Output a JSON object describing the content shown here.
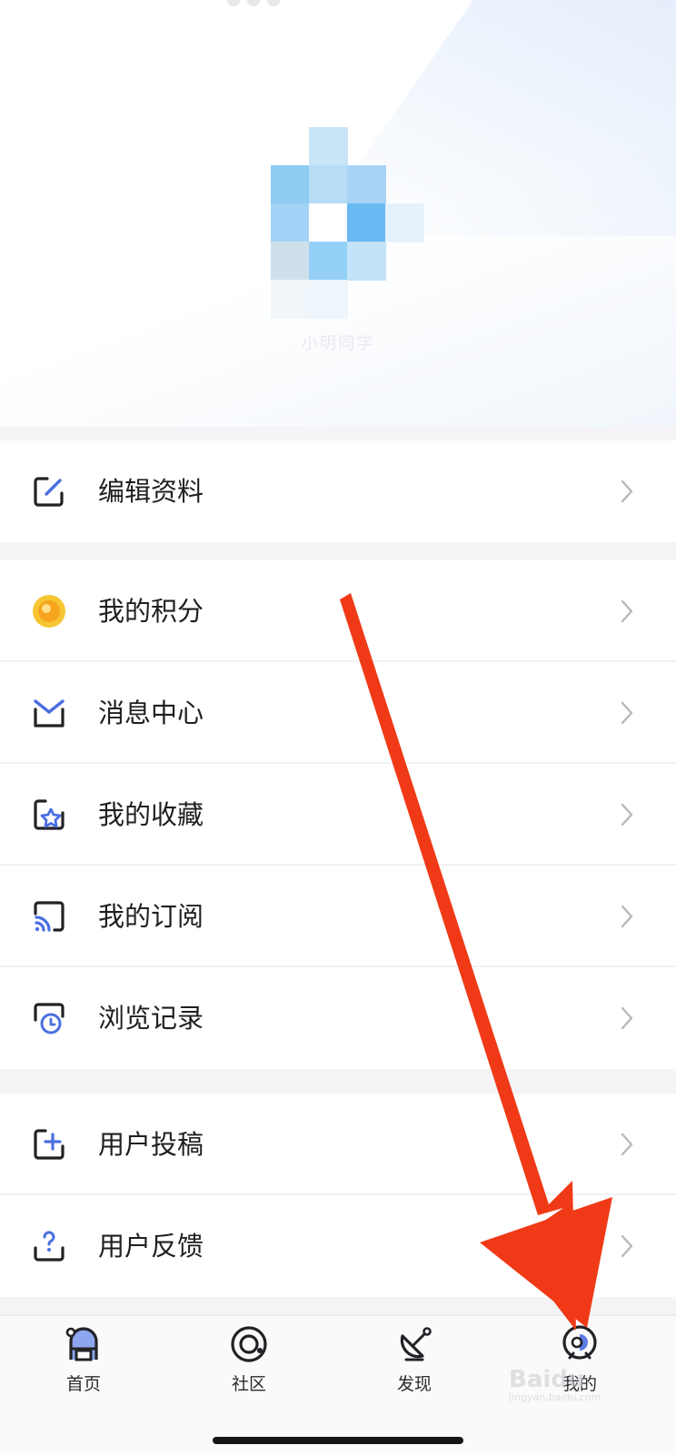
{
  "profile": {
    "username": "小明同学"
  },
  "menu": {
    "group1": [
      {
        "label": "编辑资料",
        "icon": "edit-icon"
      }
    ],
    "group2": [
      {
        "label": "我的积分",
        "icon": "coin-icon"
      },
      {
        "label": "消息中心",
        "icon": "mail-icon"
      },
      {
        "label": "我的收藏",
        "icon": "star-bookmark-icon"
      },
      {
        "label": "我的订阅",
        "icon": "rss-icon"
      },
      {
        "label": "浏览记录",
        "icon": "history-clock-icon"
      }
    ],
    "group3": [
      {
        "label": "用户投稿",
        "icon": "add-post-icon"
      },
      {
        "label": "用户反馈",
        "icon": "question-feedback-icon"
      }
    ]
  },
  "tabbar": {
    "tabs": [
      {
        "label": "首页",
        "icon": "home-astronaut-icon"
      },
      {
        "label": "社区",
        "icon": "community-planet-icon"
      },
      {
        "label": "发现",
        "icon": "discover-satellite-icon"
      },
      {
        "label": "我的",
        "icon": "profile-helmet-icon"
      }
    ]
  },
  "watermark": {
    "brand": "Baidu",
    "sub": "jingyan.baidu.com"
  },
  "colors": {
    "accent": "#4a6fe0",
    "icon_dark": "#222226",
    "coin": "#f6b820",
    "arrow": "#f03a17"
  }
}
